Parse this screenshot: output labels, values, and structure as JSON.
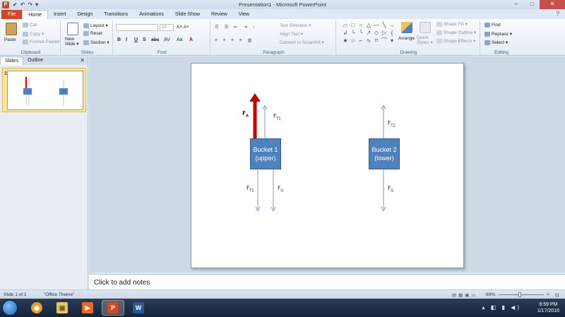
{
  "window": {
    "title": "Presentation1 - Microsoft PowerPoint",
    "app_icon_letter": "P",
    "controls": [
      "–",
      "□",
      "✕"
    ]
  },
  "quick_access": [
    "✔",
    "↶",
    "↷",
    "▾"
  ],
  "tabs": [
    {
      "label": "File"
    },
    {
      "label": "Home"
    },
    {
      "label": "Insert"
    },
    {
      "label": "Design"
    },
    {
      "label": "Transitions"
    },
    {
      "label": "Animations"
    },
    {
      "label": "Slide Show"
    },
    {
      "label": "Review"
    },
    {
      "label": "View"
    }
  ],
  "ribbon": {
    "clipboard": {
      "label": "Clipboard",
      "paste": "Paste",
      "cut": "Cut",
      "copy": "Copy ▾",
      "format_painter": "Format Painter"
    },
    "slides": {
      "label": "Slides",
      "new_slide": "New Slide ▾",
      "layout": "Layout ▾",
      "reset": "Reset",
      "section": "Section ▾"
    },
    "font": {
      "label": "Font",
      "size": "10",
      "buttons": [
        "B",
        "I",
        "U",
        "S",
        "abc",
        "AV",
        "Aa",
        "A"
      ],
      "grow": "A˄ A˅"
    },
    "paragraph": {
      "label": "Paragraph",
      "text_direction": "Text Direction ▾",
      "align_text": "Align Text ▾",
      "convert_smartart": "Convert to SmartArt ▾"
    },
    "drawing": {
      "label": "Drawing",
      "arrange": "Arrange",
      "quick_styles": "Quick Styles ▾",
      "shape_fill": "Shape Fill ▾",
      "shape_outline": "Shape Outline ▾",
      "shape_effects": "Shape Effects ▾",
      "shapes": [
        "▱",
        "□",
        "○",
        "△",
        "—",
        "╲",
        "→",
        "↲",
        "└",
        "╰",
        "↗",
        "◇",
        "▷",
        "{",
        "★",
        "☆",
        "⌐",
        "∿",
        "⌑",
        "⌒",
        "▾"
      ]
    },
    "editing": {
      "label": "Editing",
      "find": "Find",
      "replace": "Replace ▾",
      "select": "Select ▾"
    }
  },
  "left_panel": {
    "tabs": [
      "Slides",
      "Outline"
    ],
    "close": "✕",
    "slide_number": "1"
  },
  "slide": {
    "bucket1": {
      "line1": "Bucket 1",
      "line2": "(upper)"
    },
    "bucket2": {
      "line1": "Bucket 2",
      "line2": "(lower)"
    },
    "forces": {
      "fa": {
        "main": "F",
        "sub": "A"
      },
      "ft1_top": {
        "main": "F",
        "sub": "T1"
      },
      "ft1_bottom": {
        "main": "F",
        "sub": "T1"
      },
      "fg1": {
        "main": "F",
        "sub": "G"
      },
      "ft2": {
        "main": "F",
        "sub": "T2"
      },
      "fg2": {
        "main": "F",
        "sub": "G"
      }
    },
    "colors": {
      "bucket": "#4f81bd",
      "applied_force": "#c00000",
      "arrows": "#7f95c7"
    }
  },
  "notes": {
    "placeholder": "Click to add notes"
  },
  "status_bar": {
    "slide_info": "Slide 1 of 1",
    "theme": "\"Office Theme\"",
    "zoom": "69%"
  },
  "taskbar": {
    "time": "9:59 PM",
    "date": "1/17/2016",
    "apps": [
      {
        "name": "chrome",
        "glyph": "◉",
        "color": "#e0a12d"
      },
      {
        "name": "explorer",
        "glyph": "▣",
        "color": "#e5c36a"
      },
      {
        "name": "media",
        "glyph": "▶",
        "color": "#e36b25"
      },
      {
        "name": "powerpoint",
        "glyph": "P",
        "color": "#d24726"
      },
      {
        "name": "word",
        "glyph": "W",
        "color": "#2b5797"
      }
    ]
  }
}
